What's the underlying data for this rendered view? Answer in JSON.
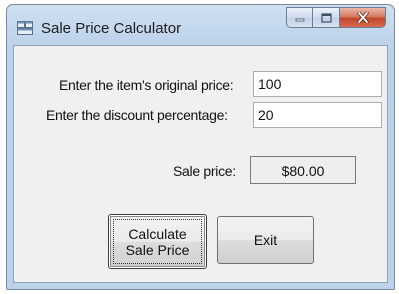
{
  "window": {
    "title": "Sale Price Calculator",
    "controls": [
      "minimize-icon",
      "maximize-icon",
      "close-icon"
    ]
  },
  "form": {
    "original_price_label": "Enter the item's original price:",
    "original_price_value": "100",
    "discount_label": "Enter the discount percentage:",
    "discount_value": "20",
    "sale_price_label": "Sale price:",
    "sale_price_value": "$80.00"
  },
  "buttons": {
    "calculate_line1": "Calculate",
    "calculate_line2": "Sale Price",
    "exit": "Exit"
  },
  "colors": {
    "title_bar": "#bcd2ea",
    "client_bg": "#f0f0f0",
    "close_button": "#c2472a"
  }
}
